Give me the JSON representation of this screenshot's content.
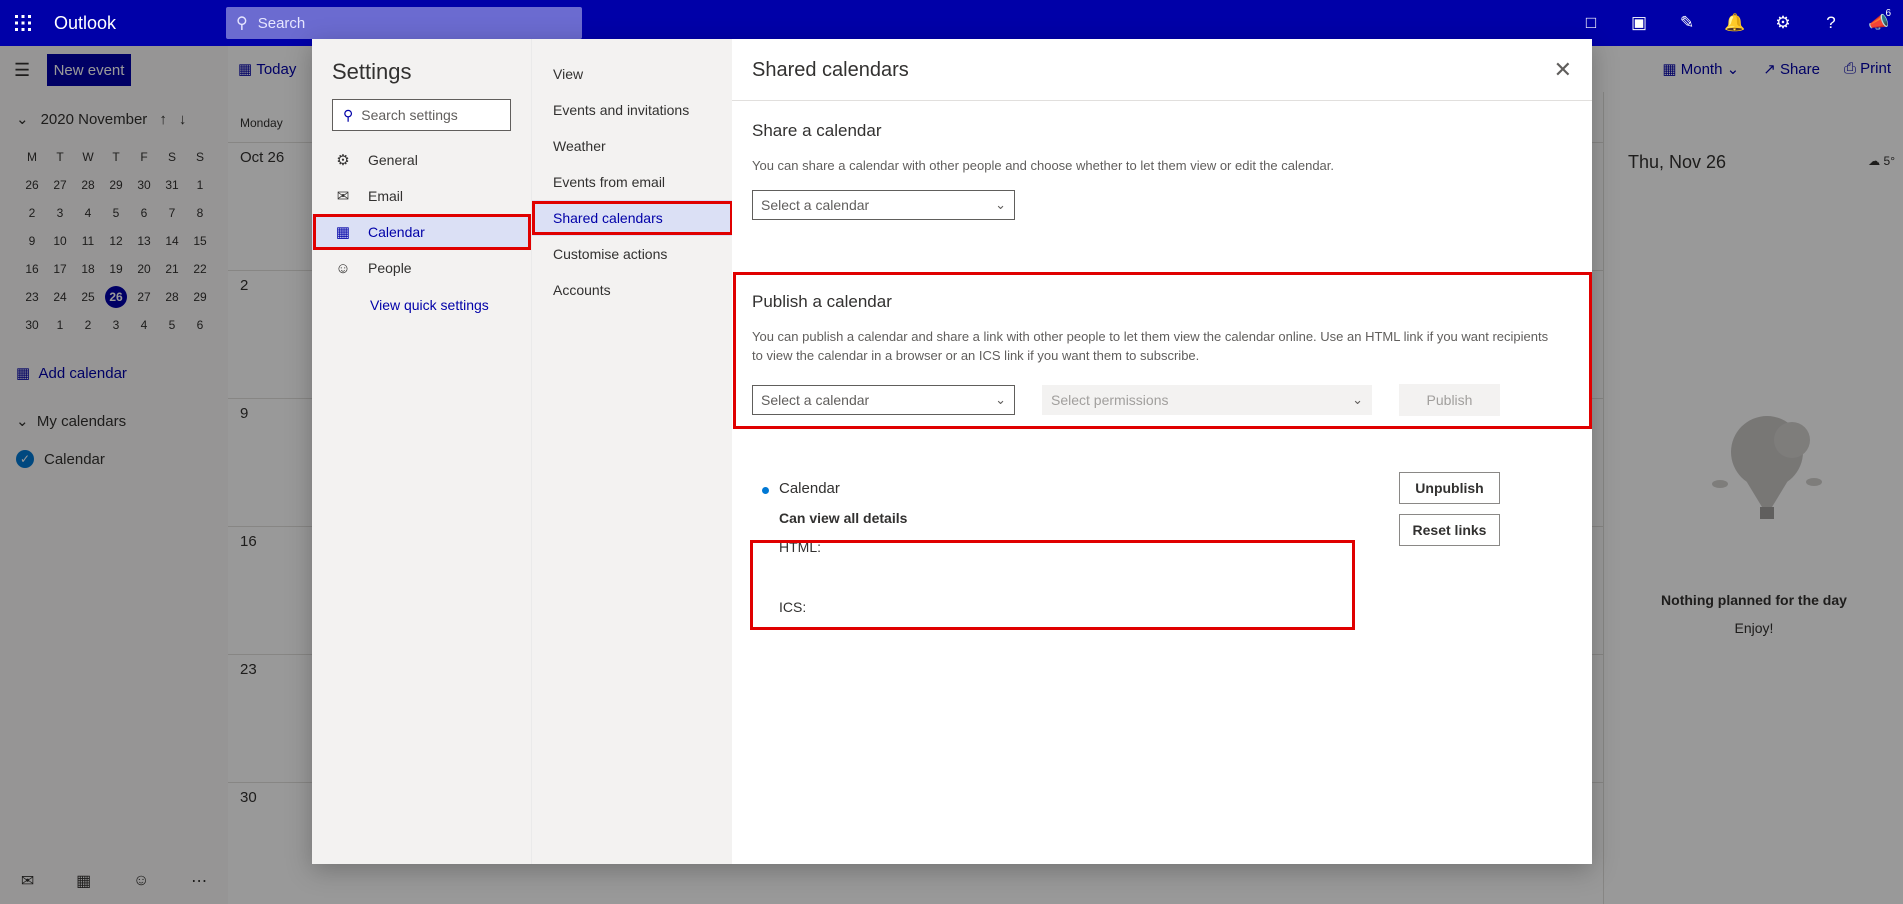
{
  "topbar": {
    "app_name": "Outlook",
    "search_placeholder": "Search",
    "notification_count": "6",
    "icons": [
      "waffle-icon",
      "teams-icon",
      "my-day-icon",
      "feedback-icon",
      "bell-icon",
      "gear-icon",
      "help-icon",
      "megaphone-icon"
    ]
  },
  "leftnav": {
    "new_event": "New event",
    "month_label": "2020 November",
    "weekdays": [
      "M",
      "T",
      "W",
      "T",
      "F",
      "S",
      "S"
    ],
    "days": [
      "26",
      "27",
      "28",
      "29",
      "30",
      "31",
      "1",
      "2",
      "3",
      "4",
      "5",
      "6",
      "7",
      "8",
      "9",
      "10",
      "11",
      "12",
      "13",
      "14",
      "15",
      "16",
      "17",
      "18",
      "19",
      "20",
      "21",
      "22",
      "23",
      "24",
      "25",
      "26",
      "27",
      "28",
      "29",
      "30",
      "1",
      "2",
      "3",
      "4",
      "5",
      "6"
    ],
    "today": "26",
    "add_calendar": "Add calendar",
    "my_calendars": "My calendars",
    "calendar_item": "Calendar"
  },
  "main": {
    "today_btn": "Today",
    "view": "Month",
    "share": "Share",
    "print": "Print",
    "day_header": "Monday",
    "week_dates": [
      "Oct 26",
      "2",
      "9",
      "16",
      "23",
      "30"
    ],
    "right_pane": {
      "date": "Thu, Nov 26",
      "weather": "5°",
      "nothing": "Nothing planned for the day",
      "enjoy": "Enjoy!"
    }
  },
  "settings": {
    "title": "Settings",
    "search_placeholder": "Search settings",
    "categories": [
      {
        "label": "General",
        "icon": "gear-icon"
      },
      {
        "label": "Email",
        "icon": "mail-icon"
      },
      {
        "label": "Calendar",
        "icon": "calendar-icon"
      },
      {
        "label": "People",
        "icon": "people-icon"
      }
    ],
    "active_category": "Calendar",
    "view_quick_settings": "View quick settings",
    "subcategories": [
      "View",
      "Events and invitations",
      "Weather",
      "Events from email",
      "Shared calendars",
      "Customise actions",
      "Accounts"
    ],
    "active_subcategory": "Shared calendars"
  },
  "pane": {
    "title": "Shared calendars",
    "share": {
      "heading": "Share a calendar",
      "description": "You can share a calendar with other people and choose whether to let them view or edit the calendar.",
      "select_calendar": "Select a calendar"
    },
    "publish": {
      "heading": "Publish a calendar",
      "description": "You can publish a calendar and share a link with other people to let them view the calendar online. Use an HTML link if you want recipients to view the calendar in a browser or an ICS link if you want them to subscribe.",
      "select_calendar": "Select a calendar",
      "select_permissions": "Select permissions",
      "publish_btn": "Publish"
    },
    "published": {
      "calendar_name": "Calendar",
      "permission": "Can view all details",
      "html_label": "HTML:",
      "ics_label": "ICS:",
      "unpublish_btn": "Unpublish",
      "reset_links_btn": "Reset links"
    }
  },
  "colors": {
    "brand": "#0000a8",
    "highlight": "#e00000",
    "accent": "#0078d4"
  }
}
